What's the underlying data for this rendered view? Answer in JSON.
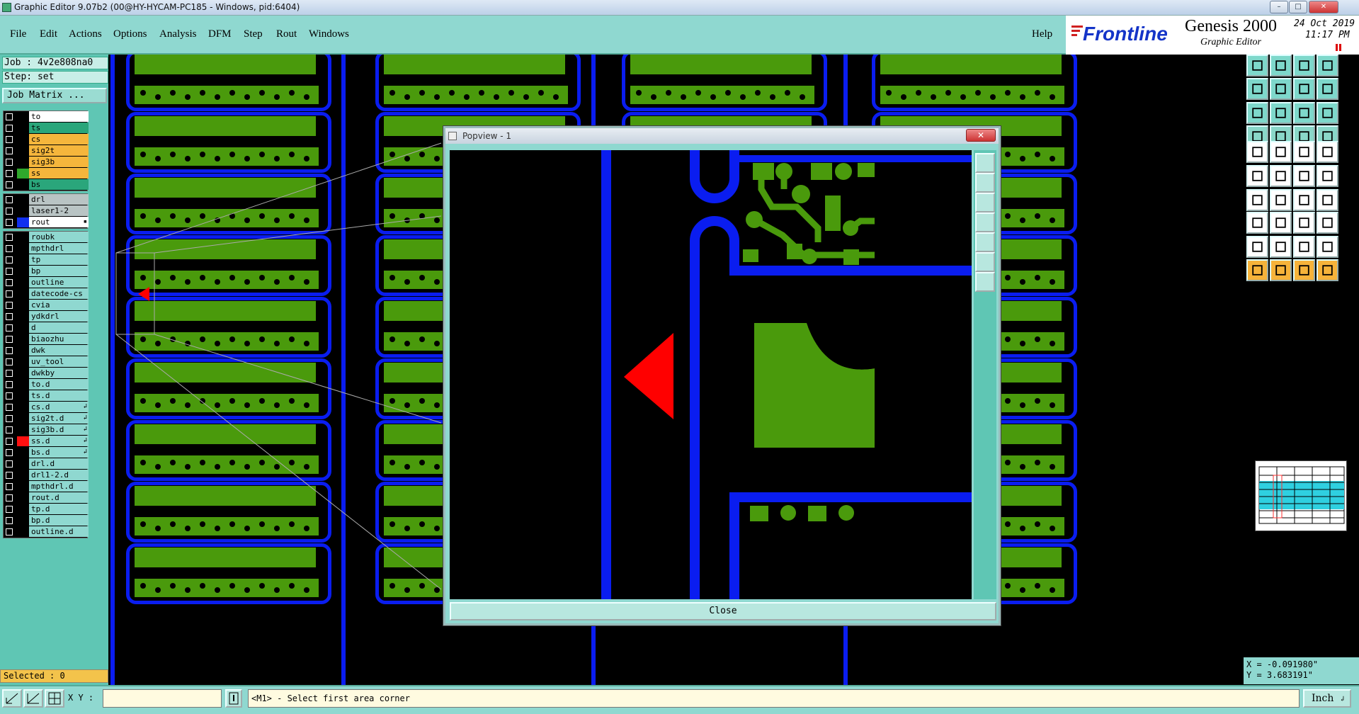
{
  "window": {
    "title": "Graphic Editor 9.07b2 (00@HY-HYCAM-PC185 - Windows, pid:6404)"
  },
  "menu": {
    "items": [
      "File",
      "Edit",
      "Actions",
      "Options",
      "Analysis",
      "DFM",
      "Step",
      "Rout",
      "Windows"
    ],
    "help": "Help"
  },
  "brand": {
    "logo": "Frontline",
    "product": "Genesis 2000",
    "subtitle": "Graphic Editor",
    "date": "24 Oct 2019",
    "time": "11:17 PM"
  },
  "job": {
    "job_label": "Job : 4v2e808na0",
    "step_label": "Step: set",
    "matrix_button": "Job Matrix ..."
  },
  "layers_group1": [
    {
      "name": "to",
      "color": "#ffffff"
    },
    {
      "name": "ts",
      "color": "#2aa67b"
    },
    {
      "name": "cs",
      "color": "#f5b63c"
    },
    {
      "name": "sig2t",
      "color": "#f5b63c"
    },
    {
      "name": "sig3b",
      "color": "#f5b63c"
    },
    {
      "name": "ss",
      "color": "#f5b63c",
      "swatch": "#2fa82c"
    },
    {
      "name": "bs",
      "color": "#2aa67b"
    }
  ],
  "layers_group2": [
    {
      "name": "drl",
      "color": "#b9c4c4"
    },
    {
      "name": "laser1-2",
      "color": "#b9c4c4"
    },
    {
      "name": "rout",
      "color": "#ffffff",
      "swatch": "#1030f0",
      "mark": "▪"
    }
  ],
  "layers_group3": [
    {
      "name": "roubk"
    },
    {
      "name": "mpthdrl"
    },
    {
      "name": "tp"
    },
    {
      "name": "bp"
    },
    {
      "name": "outline"
    },
    {
      "name": "datecode-cs"
    },
    {
      "name": "cvia"
    },
    {
      "name": "ydkdrl"
    },
    {
      "name": "d"
    },
    {
      "name": "biaozhu"
    },
    {
      "name": "dwk"
    },
    {
      "name": "uv_tool"
    },
    {
      "name": "dwkby"
    },
    {
      "name": "to.d"
    },
    {
      "name": "ts.d"
    },
    {
      "name": "cs.d",
      "mark": "↲"
    },
    {
      "name": "sig2t.d",
      "mark": "↲"
    },
    {
      "name": "sig3b.d",
      "mark": "↲"
    },
    {
      "name": "ss.d",
      "mark": "↲",
      "swatch": "#ff1010"
    },
    {
      "name": "bs.d",
      "mark": "↲"
    },
    {
      "name": "drl.d"
    },
    {
      "name": "drl1-2.d"
    },
    {
      "name": "mpthdrl.d"
    },
    {
      "name": "rout.d"
    },
    {
      "name": "tp.d"
    },
    {
      "name": "bp.d"
    },
    {
      "name": "outline.d"
    }
  ],
  "status": {
    "selected": "Selected : 0",
    "xy_label": "X Y :",
    "xy_value": "",
    "prompt": "<M1> - Select first area corner",
    "units": "Inch"
  },
  "coords": {
    "x": "X = -0.091980\"",
    "y": "Y = 3.683191\""
  },
  "popview": {
    "title": "Popview - 1",
    "close_label": "Close"
  },
  "colors": {
    "panel": "#8fd8d0",
    "copper": "#4a9a0c",
    "rout": "#0a1df0",
    "marker": "#ff0000"
  }
}
